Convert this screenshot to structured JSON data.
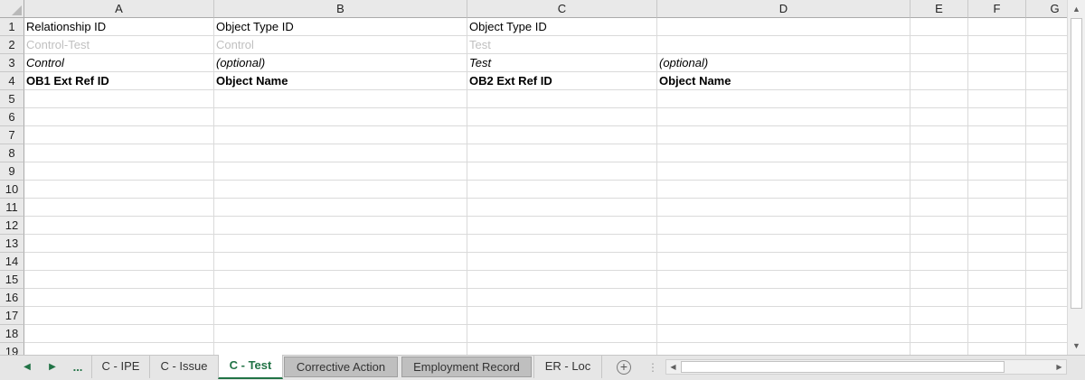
{
  "columns": [
    "A",
    "B",
    "C",
    "D",
    "E",
    "F",
    "G"
  ],
  "row_numbers": [
    "1",
    "2",
    "3",
    "4",
    "5",
    "6",
    "7",
    "8",
    "9",
    "10",
    "11",
    "12",
    "13",
    "14",
    "15",
    "16",
    "17",
    "18",
    "19"
  ],
  "rows": [
    [
      "Relationship ID",
      "Object Type ID",
      "Object Type ID",
      "",
      "",
      "",
      ""
    ],
    [
      "Control-Test",
      "Control",
      "Test",
      "",
      "",
      "",
      ""
    ],
    [
      "Control",
      "(optional)",
      "Test",
      "(optional)",
      "",
      "",
      ""
    ],
    [
      "OB1 Ext Ref ID",
      "Object Name",
      "OB2 Ext Ref ID",
      "Object Name",
      "",
      "",
      ""
    ]
  ],
  "tabs": {
    "prev_icon": "triangle-left-icon",
    "next_icon": "triangle-right-icon",
    "more": "...",
    "items": [
      {
        "label": "C - IPE",
        "state": "normal"
      },
      {
        "label": "C - Issue",
        "state": "normal"
      },
      {
        "label": "C - Test",
        "state": "active"
      },
      {
        "label": "Corrective Action",
        "state": "selected"
      },
      {
        "label": "Employment Record",
        "state": "selected"
      },
      {
        "label": "ER - Loc",
        "state": "normal"
      }
    ],
    "add_icon": "plus-circle-icon"
  },
  "colors": {
    "accent": "#217346",
    "header_bg": "#e9e9e9",
    "gridline": "#dadada",
    "placeholder_text": "#c0c0c0"
  }
}
